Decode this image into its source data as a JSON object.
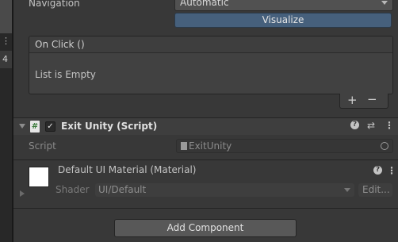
{
  "navigation": {
    "label": "Navigation",
    "value": "Automatic",
    "visualize_label": "Visualize"
  },
  "on_click": {
    "title": "On Click ()",
    "empty_text": "List is Empty",
    "add_label": "+",
    "remove_label": "−"
  },
  "left_strip": {
    "dots": "⋮",
    "number": "4"
  },
  "component": {
    "title": "Exit Unity (Script)",
    "script_icon": "#",
    "enabled_check": "✓",
    "help": "?",
    "presets": "⇄",
    "menu": "⋮",
    "script_label": "Script",
    "script_value": "ExitUnity"
  },
  "material": {
    "title": "Default UI Material (Material)",
    "help": "?",
    "menu": "⋮",
    "shader_label": "Shader",
    "shader_value": "UI/Default",
    "edit_label": "Edit..."
  },
  "add_component_label": "Add Component"
}
